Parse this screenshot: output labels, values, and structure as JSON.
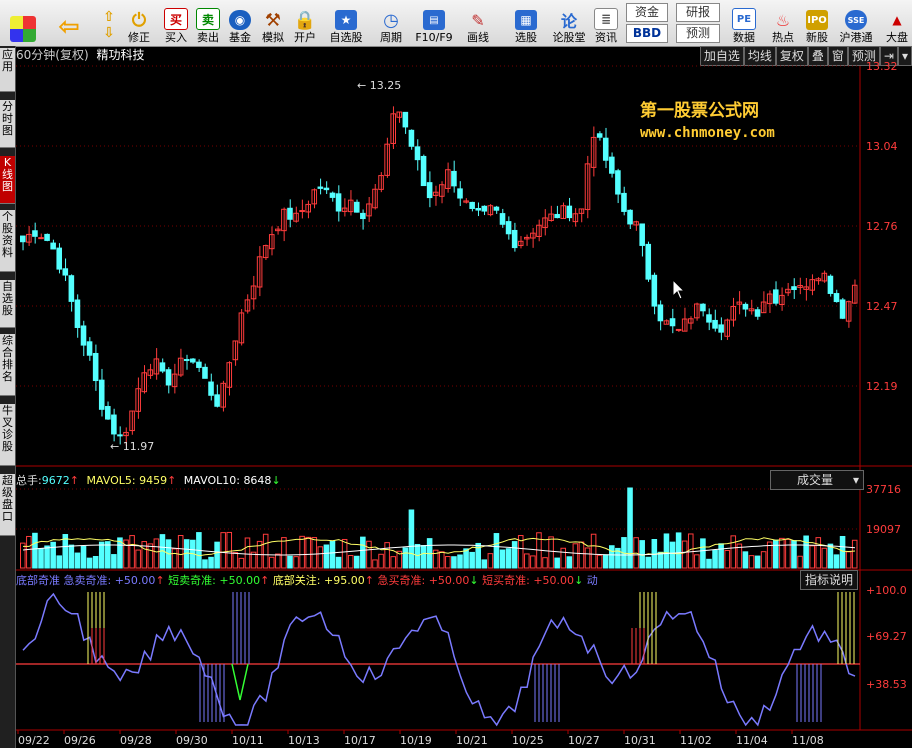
{
  "toolbar": {
    "items": [
      {
        "label": "",
        "icon": "window-icon"
      },
      {
        "label": "",
        "icon": "back-arrow-icon"
      },
      {
        "label": "",
        "icon": "up-down-icon"
      },
      {
        "label": "修正",
        "icon": "power-icon"
      },
      {
        "label": "买入",
        "icon": "buy-icon",
        "glyph": "买"
      },
      {
        "label": "卖出",
        "icon": "sell-icon",
        "glyph": "卖"
      },
      {
        "label": "基金",
        "icon": "fund-icon"
      },
      {
        "label": "模拟",
        "icon": "hammer-icon"
      },
      {
        "label": "开户",
        "icon": "lock-icon"
      },
      {
        "label": "自选股",
        "icon": "star-icon"
      },
      {
        "label": "周期",
        "icon": "clock-icon"
      },
      {
        "label": "F10/F9",
        "icon": "f10-icon"
      },
      {
        "label": "画线",
        "icon": "pen-icon"
      },
      {
        "label": "选股",
        "icon": "screen-icon"
      },
      {
        "label": "论股堂",
        "icon": "forum-icon",
        "glyph": "论"
      },
      {
        "label": "资讯",
        "icon": "news-icon"
      },
      {
        "label": "数据",
        "icon": "pe-icon",
        "glyph": "PE"
      },
      {
        "label": "热点",
        "icon": "hot-icon"
      },
      {
        "label": "新股",
        "icon": "ipo-icon"
      },
      {
        "label": "沪港通",
        "icon": "hk-connect-icon"
      },
      {
        "label": "大盘",
        "icon": "index-icon"
      }
    ],
    "small_buttons": {
      "fund_flow": "资金",
      "research": "研报",
      "bbd": "BBD",
      "forecast": "预测"
    }
  },
  "sidebar": {
    "tabs": [
      "应用",
      "分时图",
      "K线图",
      "个股资料",
      "自选股",
      "综合排名",
      "牛叉诊股",
      "超级盘口"
    ],
    "active_index": 2
  },
  "main_chart": {
    "period_label": "60分钟(复权)",
    "stock_name": "精功科技",
    "buttons": [
      "加自选",
      "均线",
      "复权",
      "叠",
      "窗",
      "预测"
    ],
    "y_ticks": [
      "13.32",
      "13.04",
      "12.76",
      "12.47",
      "12.19"
    ],
    "high_label": "13.25",
    "low_label": "11.97",
    "watermark_cn": "第一股票公式网",
    "watermark_url": "www.chnmoney.com",
    "up_color": "#ff3c3c",
    "down_color": "#54ffff"
  },
  "volume_panel": {
    "label_total": "总手:",
    "total_value": "9672",
    "mavol5_label": "MAVOL5:",
    "mavol5_value": "9459",
    "mavol10_label": "MAVOL10:",
    "mavol10_value": "8648",
    "dropdown": "成交量",
    "y_ticks": [
      "37716",
      "19097"
    ]
  },
  "indicator_panel": {
    "name": "底部奇准",
    "items": [
      {
        "label": "急卖奇准:",
        "value": "+50.00",
        "arrow": "↑",
        "color": "#7a7aff"
      },
      {
        "label": "短卖奇准:",
        "value": "+50.00",
        "arrow": "↑",
        "color": "#33ff33"
      },
      {
        "label": "底部关注:",
        "value": "+95.00",
        "arrow": "↑",
        "color": "#ffff66"
      },
      {
        "label": "急买奇准:",
        "value": "+50.00",
        "arrow": "↓",
        "color": "#ff3c3c"
      },
      {
        "label": "短买奇准:",
        "value": "+50.00",
        "arrow": "↓",
        "color": "#ff3c3c"
      }
    ],
    "tail": "动",
    "help_button": "指标说明",
    "y_ticks": [
      "+100.0",
      "+69.27",
      "+38.53"
    ]
  },
  "x_axis": [
    "09/22",
    "09/26",
    "09/28",
    "09/30",
    "10/11",
    "10/13",
    "10/17",
    "10/19",
    "10/21",
    "10/25",
    "10/27",
    "10/31",
    "11/02",
    "11/04",
    "11/08"
  ]
}
